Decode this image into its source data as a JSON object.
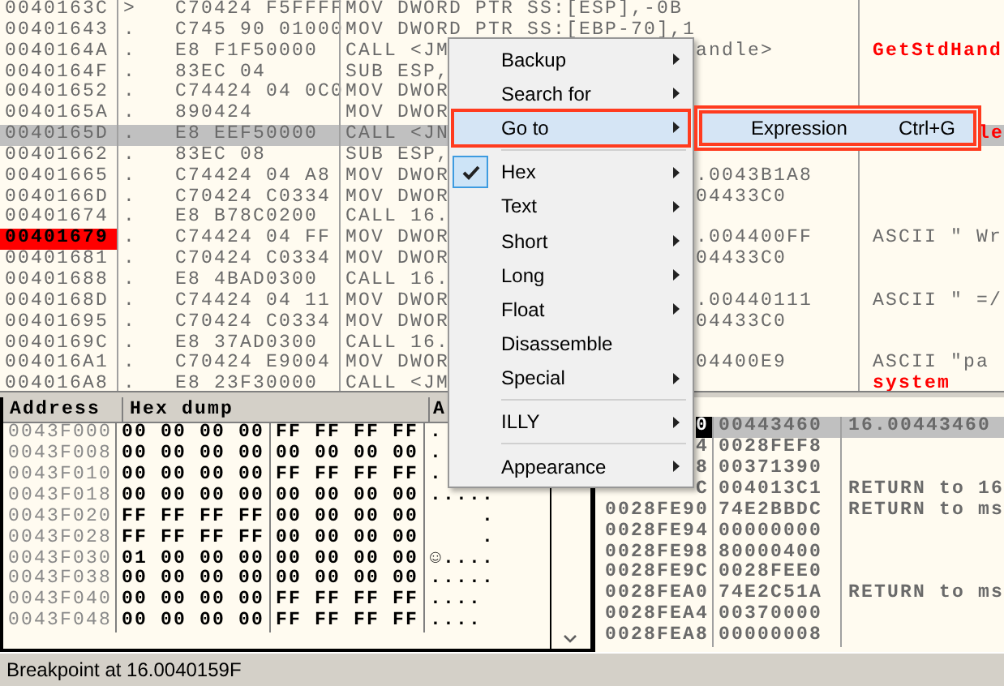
{
  "disasm": {
    "rows": [
      {
        "address": "0040163C",
        "marker": ">",
        "hex": "C70424 F5FFFF",
        "code": "MOV DWORD PTR SS:[ESP],-0B",
        "selected": false,
        "breakpoint": false
      },
      {
        "address": "00401643",
        "marker": ".",
        "hex": "C745 90 01000",
        "code": "MOV DWORD PTR SS:[EBP-70],1",
        "selected": false,
        "breakpoint": false
      },
      {
        "address": "0040164A",
        "marker": ".",
        "hex": "E8 F1F50000",
        "code": "CALL <JM",
        "tail": "andle>",
        "comment": {
          "text": "GetStdHand",
          "kind": "api"
        },
        "selected": false,
        "breakpoint": false
      },
      {
        "address": "0040164F",
        "marker": ".",
        "hex": "83EC 04",
        "code": "SUB ESP,",
        "selected": false,
        "breakpoint": false
      },
      {
        "address": "00401652",
        "marker": ".",
        "hex": "C74424 04 0C0",
        "code": "MOV DWOR",
        "selected": false,
        "breakpoint": false
      },
      {
        "address": "0040165A",
        "marker": ".",
        "hex": "890424",
        "code": "MOV DWOR",
        "selected": false,
        "breakpoint": false
      },
      {
        "address": "0040165D",
        "marker": ".",
        "hex": "E8 EEF50000",
        "code": "CALL <JN",
        "comment_tail": {
          "text": "le",
          "kind": "api"
        },
        "selected": true,
        "breakpoint": false
      },
      {
        "address": "00401662",
        "marker": ".",
        "hex": "83EC 08",
        "code": "SUB ESP,",
        "selected": false,
        "breakpoint": false
      },
      {
        "address": "00401665",
        "marker": ".",
        "hex": "C74424 04 A8",
        "code": "MOV DWOR",
        "tail": ".0043B1A8",
        "selected": false,
        "breakpoint": false
      },
      {
        "address": "0040166D",
        "marker": ".",
        "hex": "C70424 C0334",
        "code": "MOV DWOR",
        "tail": "04433C0",
        "selected": false,
        "breakpoint": false
      },
      {
        "address": "00401674",
        "marker": ".",
        "hex": "E8 B78C0200",
        "code": "CALL 16.",
        "selected": false,
        "breakpoint": false
      },
      {
        "address": "00401679",
        "marker": ".",
        "hex": "C74424 04 FF",
        "code": "MOV DWOR",
        "tail": ".004400FF",
        "comment": {
          "text": "ASCII \" Wr",
          "kind": "string"
        },
        "selected": false,
        "breakpoint": true
      },
      {
        "address": "00401681",
        "marker": ".",
        "hex": "C70424 C0334",
        "code": "MOV DWOR",
        "tail": "04433C0",
        "selected": false,
        "breakpoint": false
      },
      {
        "address": "00401688",
        "marker": ".",
        "hex": "E8 4BAD0300",
        "code": "CALL 16.",
        "selected": false,
        "breakpoint": false
      },
      {
        "address": "0040168D",
        "marker": ".",
        "hex": "C74424 04 11",
        "code": "MOV DWOR",
        "tail": ".00440111",
        "comment": {
          "text": "ASCII \" =/",
          "kind": "string"
        },
        "selected": false,
        "breakpoint": false
      },
      {
        "address": "00401695",
        "marker": ".",
        "hex": "C70424 C0334",
        "code": "MOV DWOR",
        "tail": "04433C0",
        "selected": false,
        "breakpoint": false
      },
      {
        "address": "0040169C",
        "marker": ".",
        "hex": "E8 37AD0300",
        "code": "CALL 16.",
        "selected": false,
        "breakpoint": false
      },
      {
        "address": "004016A1",
        "marker": ".",
        "hex": "C70424 E9004",
        "code": "MOV DWOR",
        "tail": "04400E9",
        "comment": {
          "text": "ASCII \"pa",
          "kind": "string"
        },
        "selected": false,
        "breakpoint": false
      },
      {
        "address": "004016A8",
        "marker": ".",
        "hex": "E8 23F30000",
        "code": "CALL <JM",
        "comment": {
          "text": "system",
          "kind": "api"
        },
        "selected": false,
        "breakpoint": false
      }
    ]
  },
  "dump": {
    "columns": [
      "Address",
      "Hex dump",
      "A"
    ],
    "rows": [
      {
        "address": "0043F000",
        "hex": [
          "00 00 00 00",
          "FF FF FF FF"
        ],
        "ascii": "."
      },
      {
        "address": "0043F008",
        "hex": [
          "00 00 00 00",
          "00 00 00 00"
        ],
        "ascii": "."
      },
      {
        "address": "0043F010",
        "hex": [
          "00 00 00 00",
          "FF FF FF FF"
        ],
        "ascii": "."
      },
      {
        "address": "0043F018",
        "hex": [
          "00 00 00 00",
          "00 00 00 00"
        ],
        "ascii": "....."
      },
      {
        "address": "0043F020",
        "hex": [
          "FF FF FF FF",
          "00 00 00 00"
        ],
        "ascii": "    ."
      },
      {
        "address": "0043F028",
        "hex": [
          "FF FF FF FF",
          "00 00 00 00"
        ],
        "ascii": "    ."
      },
      {
        "address": "0043F030",
        "hex": [
          "01 00 00 00",
          "00 00 00 00"
        ],
        "ascii": "☺...."
      },
      {
        "address": "0043F038",
        "hex": [
          "00 00 00 00",
          "00 00 00 00"
        ],
        "ascii": "....."
      },
      {
        "address": "0043F040",
        "hex": [
          "00 00 00 00",
          "FF FF FF FF"
        ],
        "ascii": "...."
      },
      {
        "address": "0043F048",
        "hex": [
          "00 00 00 00",
          "FF FF FF FF"
        ],
        "ascii": "...."
      }
    ]
  },
  "stack": {
    "rows": [
      {
        "address": "0",
        "value": "00443460",
        "comment": "16.00443460",
        "selected": true
      },
      {
        "address": "4",
        "value": "0028FEF8",
        "selected": false
      },
      {
        "address": "8",
        "value": "00371390",
        "selected": false
      },
      {
        "address": "C",
        "value": "004013C1",
        "comment": "RETURN to 16",
        "selected": false
      },
      {
        "address": "0028FE90",
        "value": "74E2BBDC",
        "comment": "RETURN to ms",
        "selected": false
      },
      {
        "address": "0028FE94",
        "value": "00000000",
        "selected": false
      },
      {
        "address": "0028FE98",
        "value": "80000400",
        "selected": false
      },
      {
        "address": "0028FE9C",
        "value": "0028FEE0",
        "selected": false
      },
      {
        "address": "0028FEA0",
        "value": "74E2C51A",
        "comment": "RETURN to ms",
        "selected": false
      },
      {
        "address": "0028FEA4",
        "value": "00370000",
        "selected": false
      },
      {
        "address": "0028FEA8",
        "value": "00000008",
        "selected": false
      }
    ]
  },
  "context_menu": {
    "items": [
      {
        "kind": "item",
        "label": "Backup",
        "submenu": true,
        "checked": false,
        "selected": false
      },
      {
        "kind": "item",
        "label": "Search for",
        "submenu": true,
        "checked": false,
        "selected": false
      },
      {
        "kind": "item",
        "label": "Go to",
        "submenu": true,
        "checked": false,
        "selected": true
      },
      {
        "kind": "separator"
      },
      {
        "kind": "item",
        "label": "Hex",
        "submenu": true,
        "checked": true,
        "selected": false
      },
      {
        "kind": "item",
        "label": "Text",
        "submenu": true,
        "checked": false,
        "selected": false
      },
      {
        "kind": "item",
        "label": "Short",
        "submenu": true,
        "checked": false,
        "selected": false
      },
      {
        "kind": "item",
        "label": "Long",
        "submenu": true,
        "checked": false,
        "selected": false
      },
      {
        "kind": "item",
        "label": "Float",
        "submenu": true,
        "checked": false,
        "selected": false
      },
      {
        "kind": "item",
        "label": "Disassemble",
        "submenu": false,
        "checked": false,
        "selected": false
      },
      {
        "kind": "item",
        "label": "Special",
        "submenu": true,
        "checked": false,
        "selected": false
      },
      {
        "kind": "separator"
      },
      {
        "kind": "item",
        "label": "ILLY",
        "submenu": true,
        "checked": false,
        "selected": false
      },
      {
        "kind": "separator"
      },
      {
        "kind": "item",
        "label": "Appearance",
        "submenu": true,
        "checked": false,
        "selected": false
      }
    ]
  },
  "submenu": {
    "items": [
      {
        "label": "Expression",
        "shortcut": "Ctrl+G",
        "selected": true
      }
    ]
  },
  "status_bar": "Breakpoint at 16.0040159F"
}
